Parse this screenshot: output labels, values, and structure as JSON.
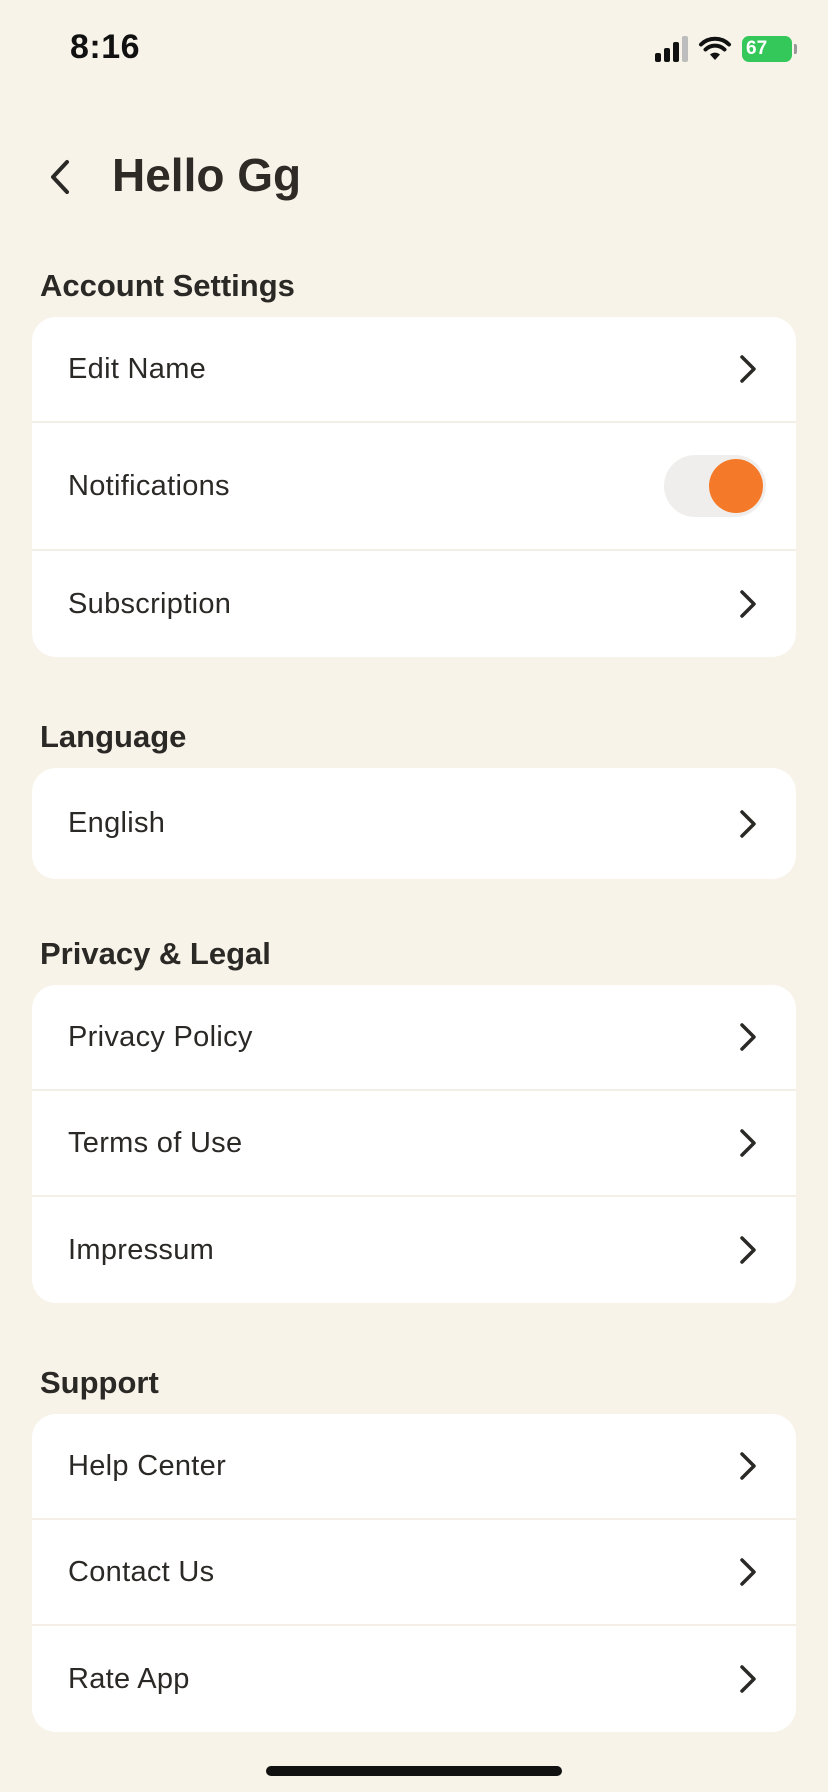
{
  "status_bar": {
    "time": "8:16",
    "battery": "67",
    "icons": [
      "cellular-signal-icon",
      "wifi-icon",
      "battery-charging-icon"
    ]
  },
  "header": {
    "title": "Hello Gg",
    "back_icon": "chevron-left-icon"
  },
  "sections": {
    "account": {
      "title": "Account Settings",
      "edit_name": "Edit Name",
      "notifications": "Notifications",
      "notifications_enabled": true,
      "subscription": "Subscription"
    },
    "language": {
      "title": "Language",
      "current": "English"
    },
    "privacy": {
      "title": "Privacy & Legal",
      "privacy_policy": "Privacy Policy",
      "terms": "Terms of Use",
      "impressum": "Impressum"
    },
    "support": {
      "title": "Support",
      "help_center": "Help Center",
      "contact_us": "Contact Us",
      "rate_app": "Rate App"
    }
  },
  "colors": {
    "background": "#f8f3e9",
    "accent": "#f47a29",
    "card": "#ffffff",
    "battery": "#34c759"
  }
}
